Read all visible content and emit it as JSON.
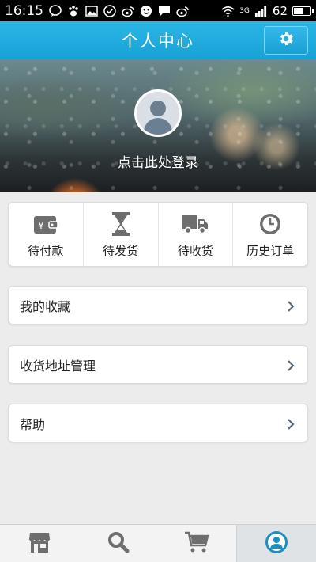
{
  "status_bar": {
    "time": "16:15",
    "network": "3G",
    "battery": "62",
    "battery_level": 0.62
  },
  "header": {
    "title": "个人中心"
  },
  "profile": {
    "login_prompt": "点击此处登录"
  },
  "orders": [
    {
      "label": "待付款",
      "icon": "wallet-yen-icon"
    },
    {
      "label": "待发货",
      "icon": "hourglass-icon"
    },
    {
      "label": "待收货",
      "icon": "truck-icon"
    },
    {
      "label": "历史订单",
      "icon": "clock-icon"
    }
  ],
  "menu": [
    {
      "label": "我的收藏"
    },
    {
      "label": "收货地址管理"
    },
    {
      "label": "帮助"
    }
  ],
  "tabs": [
    {
      "name": "store-icon"
    },
    {
      "name": "search-icon"
    },
    {
      "name": "cart-icon"
    },
    {
      "name": "user-icon",
      "active": true
    }
  ],
  "colors": {
    "accent": "#1ca4d9",
    "icon_gray": "#6e6e6e",
    "active_tab_icon": "#1a8fc4"
  }
}
